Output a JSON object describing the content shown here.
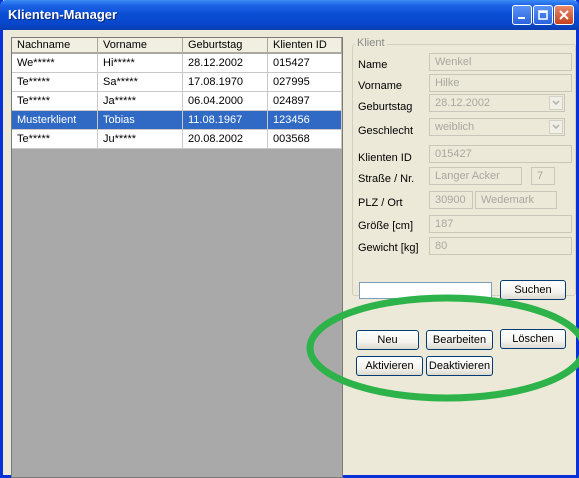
{
  "window": {
    "title": "Klienten-Manager"
  },
  "table": {
    "columns": [
      "Nachname",
      "Vorname",
      "Geburtstag",
      "Klienten ID"
    ],
    "rows": [
      {
        "nachname": "We*****",
        "vorname": "Hi*****",
        "geburtstag": "28.12.2002",
        "id": "015427",
        "selected": false
      },
      {
        "nachname": "Te*****",
        "vorname": "Sa*****",
        "geburtstag": "17.08.1970",
        "id": "027995",
        "selected": false
      },
      {
        "nachname": "Te*****",
        "vorname": "Ja*****",
        "geburtstag": "06.04.2000",
        "id": "024897",
        "selected": false
      },
      {
        "nachname": "Musterklient",
        "vorname": "Tobias",
        "geburtstag": "11.08.1967",
        "id": "123456",
        "selected": true
      },
      {
        "nachname": "Te*****",
        "vorname": "Ju*****",
        "geburtstag": "20.08.2002",
        "id": "003568",
        "selected": false
      }
    ]
  },
  "client": {
    "legend": "Klient",
    "labels": {
      "name": "Name",
      "vorname": "Vorname",
      "geburtstag": "Geburtstag",
      "geschlecht": "Geschlecht",
      "klienten_id": "Klienten ID",
      "strasse": "Straße / Nr.",
      "plz": "PLZ / Ort",
      "groesse": "Größe [cm]",
      "gewicht": "Gewicht [kg]"
    },
    "values": {
      "name": "Wenkel",
      "vorname": "Hilke",
      "geburtstag": "28.12.2002",
      "geschlecht": "weiblich",
      "klienten_id": "015427",
      "strasse": "Langer Acker",
      "hausnr": "7",
      "plz": "30900",
      "ort": "Wedemark",
      "groesse": "187",
      "gewicht": "80"
    }
  },
  "search": {
    "value": "",
    "button": "Suchen"
  },
  "actions": {
    "neu": "Neu",
    "bearbeiten": "Bearbeiten",
    "loeschen": "Löschen",
    "aktivieren": "Aktivieren",
    "deaktivieren": "Deaktivieren"
  },
  "colors": {
    "highlight": "#2db34a",
    "selection": "#316ac5",
    "titlebar": "#0a4fd6"
  }
}
